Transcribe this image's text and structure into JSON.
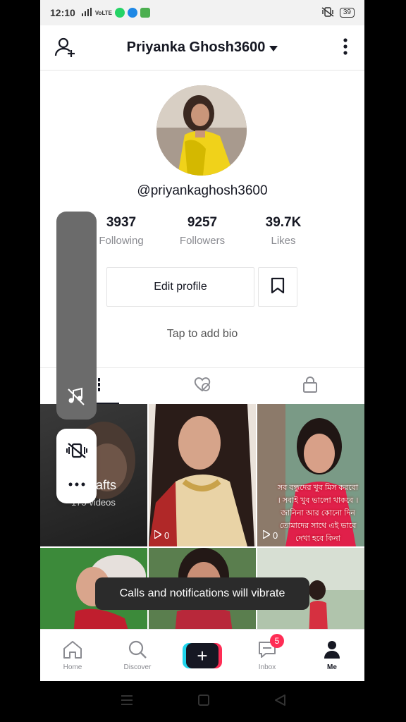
{
  "statusbar": {
    "time": "12:10",
    "battery": "39",
    "signal_text": "VoLTE"
  },
  "header": {
    "username": "Priyanka Ghosh3600"
  },
  "profile": {
    "handle": "@priyankaghosh3600",
    "bio_placeholder": "Tap to add bio"
  },
  "stats": [
    {
      "value": "3937",
      "label": "Following"
    },
    {
      "value": "9257",
      "label": "Followers"
    },
    {
      "value": "39.7K",
      "label": "Likes"
    }
  ],
  "buttons": {
    "edit_profile": "Edit profile"
  },
  "grid": {
    "drafts_label": "Drafts",
    "drafts_count": "175 videos",
    "cell2_views": "0",
    "cell3_views": "0",
    "cell3_overlay": "সব বন্ধুদের খুব মিস করবো । সবাই খুব ভালো থাকবে । জানিনা আর কোনো দিন তোমাদের সাথে এই ভাবে দেখা হবে কিনা"
  },
  "toast": "Calls and notifications will vibrate",
  "bottom_nav": [
    {
      "label": "Home",
      "icon": "home-icon"
    },
    {
      "label": "Discover",
      "icon": "search-icon"
    },
    {
      "label": "",
      "icon": "plus-icon"
    },
    {
      "label": "Inbox",
      "icon": "inbox-icon",
      "badge": "5"
    },
    {
      "label": "Me",
      "icon": "person-icon"
    }
  ],
  "colors": {
    "accent_pink": "#ff2d55",
    "accent_cyan": "#20d5ec",
    "text_primary": "#161823",
    "text_secondary": "#8a8b91"
  }
}
